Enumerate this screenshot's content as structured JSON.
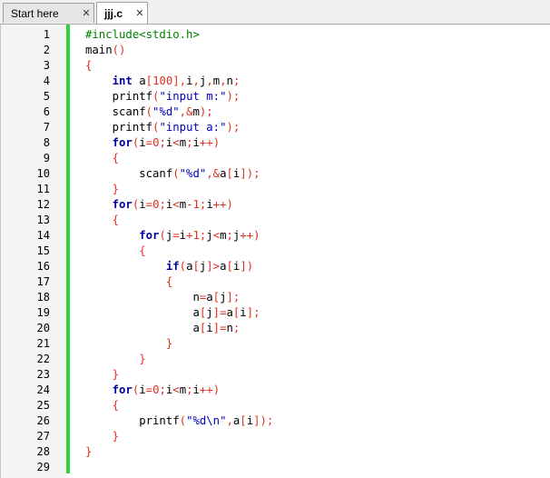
{
  "tabs": [
    {
      "label": "Start here",
      "close": "✕",
      "active": false
    },
    {
      "label": "jjj.c",
      "close": "✕",
      "active": true
    }
  ],
  "editor": {
    "line_numbers": [
      "1",
      "2",
      "3",
      "4",
      "5",
      "6",
      "7",
      "8",
      "9",
      "10",
      "11",
      "12",
      "13",
      "14",
      "15",
      "16",
      "17",
      "18",
      "19",
      "20",
      "21",
      "22",
      "23",
      "24",
      "25",
      "26",
      "27",
      "28",
      "29"
    ],
    "lines": [
      [
        {
          "t": "#include<stdio.h>",
          "c": "pp"
        }
      ],
      [
        {
          "t": "main",
          "c": ""
        },
        {
          "t": "()",
          "c": "br"
        }
      ],
      [
        {
          "t": "{",
          "c": "br"
        }
      ],
      [
        {
          "t": "    ",
          "c": ""
        },
        {
          "t": "int",
          "c": "kw"
        },
        {
          "t": " a",
          "c": ""
        },
        {
          "t": "[",
          "c": "br"
        },
        {
          "t": "100",
          "c": "num-lit"
        },
        {
          "t": "],",
          "c": "br"
        },
        {
          "t": "i",
          "c": ""
        },
        {
          "t": ",",
          "c": "br"
        },
        {
          "t": "j",
          "c": ""
        },
        {
          "t": ",",
          "c": "br"
        },
        {
          "t": "m",
          "c": ""
        },
        {
          "t": ",",
          "c": "br"
        },
        {
          "t": "n",
          "c": ""
        },
        {
          "t": ";",
          "c": "br"
        }
      ],
      [
        {
          "t": "    printf",
          "c": ""
        },
        {
          "t": "(",
          "c": "br"
        },
        {
          "t": "\"input m:\"",
          "c": "str"
        },
        {
          "t": ");",
          "c": "br"
        }
      ],
      [
        {
          "t": "    scanf",
          "c": ""
        },
        {
          "t": "(",
          "c": "br"
        },
        {
          "t": "\"%d\"",
          "c": "str"
        },
        {
          "t": ",&",
          "c": "br"
        },
        {
          "t": "m",
          "c": ""
        },
        {
          "t": ");",
          "c": "br"
        }
      ],
      [
        {
          "t": "    printf",
          "c": ""
        },
        {
          "t": "(",
          "c": "br"
        },
        {
          "t": "\"input a:\"",
          "c": "str"
        },
        {
          "t": ");",
          "c": "br"
        }
      ],
      [
        {
          "t": "    ",
          "c": ""
        },
        {
          "t": "for",
          "c": "kw"
        },
        {
          "t": "(",
          "c": "br"
        },
        {
          "t": "i",
          "c": ""
        },
        {
          "t": "=",
          "c": "br"
        },
        {
          "t": "0",
          "c": "num-lit"
        },
        {
          "t": ";",
          "c": "br"
        },
        {
          "t": "i",
          "c": ""
        },
        {
          "t": "<",
          "c": "br"
        },
        {
          "t": "m",
          "c": ""
        },
        {
          "t": ";",
          "c": "br"
        },
        {
          "t": "i",
          "c": ""
        },
        {
          "t": "++)",
          "c": "br"
        }
      ],
      [
        {
          "t": "    ",
          "c": ""
        },
        {
          "t": "{",
          "c": "br"
        }
      ],
      [
        {
          "t": "        scanf",
          "c": ""
        },
        {
          "t": "(",
          "c": "br"
        },
        {
          "t": "\"%d\"",
          "c": "str"
        },
        {
          "t": ",&",
          "c": "br"
        },
        {
          "t": "a",
          "c": ""
        },
        {
          "t": "[",
          "c": "br"
        },
        {
          "t": "i",
          "c": ""
        },
        {
          "t": "]);",
          "c": "br"
        }
      ],
      [
        {
          "t": "    ",
          "c": ""
        },
        {
          "t": "}",
          "c": "br"
        }
      ],
      [
        {
          "t": "    ",
          "c": ""
        },
        {
          "t": "for",
          "c": "kw"
        },
        {
          "t": "(",
          "c": "br"
        },
        {
          "t": "i",
          "c": ""
        },
        {
          "t": "=",
          "c": "br"
        },
        {
          "t": "0",
          "c": "num-lit"
        },
        {
          "t": ";",
          "c": "br"
        },
        {
          "t": "i",
          "c": ""
        },
        {
          "t": "<",
          "c": "br"
        },
        {
          "t": "m",
          "c": ""
        },
        {
          "t": "-",
          "c": "br"
        },
        {
          "t": "1",
          "c": "num-lit"
        },
        {
          "t": ";",
          "c": "br"
        },
        {
          "t": "i",
          "c": ""
        },
        {
          "t": "++)",
          "c": "br"
        }
      ],
      [
        {
          "t": "    ",
          "c": ""
        },
        {
          "t": "{",
          "c": "br"
        }
      ],
      [
        {
          "t": "        ",
          "c": ""
        },
        {
          "t": "for",
          "c": "kw"
        },
        {
          "t": "(",
          "c": "br"
        },
        {
          "t": "j",
          "c": ""
        },
        {
          "t": "=",
          "c": "br"
        },
        {
          "t": "i",
          "c": ""
        },
        {
          "t": "+",
          "c": "br"
        },
        {
          "t": "1",
          "c": "num-lit"
        },
        {
          "t": ";",
          "c": "br"
        },
        {
          "t": "j",
          "c": ""
        },
        {
          "t": "<",
          "c": "br"
        },
        {
          "t": "m",
          "c": ""
        },
        {
          "t": ";",
          "c": "br"
        },
        {
          "t": "j",
          "c": ""
        },
        {
          "t": "++)",
          "c": "br"
        }
      ],
      [
        {
          "t": "        ",
          "c": ""
        },
        {
          "t": "{",
          "c": "br"
        }
      ],
      [
        {
          "t": "            ",
          "c": ""
        },
        {
          "t": "if",
          "c": "kw"
        },
        {
          "t": "(",
          "c": "br"
        },
        {
          "t": "a",
          "c": ""
        },
        {
          "t": "[",
          "c": "br"
        },
        {
          "t": "j",
          "c": ""
        },
        {
          "t": "]>",
          "c": "br"
        },
        {
          "t": "a",
          "c": ""
        },
        {
          "t": "[",
          "c": "br"
        },
        {
          "t": "i",
          "c": ""
        },
        {
          "t": "])",
          "c": "br"
        }
      ],
      [
        {
          "t": "            ",
          "c": ""
        },
        {
          "t": "{",
          "c": "br"
        }
      ],
      [
        {
          "t": "                n",
          "c": ""
        },
        {
          "t": "=",
          "c": "br"
        },
        {
          "t": "a",
          "c": ""
        },
        {
          "t": "[",
          "c": "br"
        },
        {
          "t": "j",
          "c": ""
        },
        {
          "t": "];",
          "c": "br"
        }
      ],
      [
        {
          "t": "                a",
          "c": ""
        },
        {
          "t": "[",
          "c": "br"
        },
        {
          "t": "j",
          "c": ""
        },
        {
          "t": "]=",
          "c": "br"
        },
        {
          "t": "a",
          "c": ""
        },
        {
          "t": "[",
          "c": "br"
        },
        {
          "t": "i",
          "c": ""
        },
        {
          "t": "];",
          "c": "br"
        }
      ],
      [
        {
          "t": "                a",
          "c": ""
        },
        {
          "t": "[",
          "c": "br"
        },
        {
          "t": "i",
          "c": ""
        },
        {
          "t": "]=",
          "c": "br"
        },
        {
          "t": "n",
          "c": ""
        },
        {
          "t": ";",
          "c": "br"
        }
      ],
      [
        {
          "t": "            ",
          "c": ""
        },
        {
          "t": "}",
          "c": "br"
        }
      ],
      [
        {
          "t": "        ",
          "c": ""
        },
        {
          "t": "}",
          "c": "br"
        }
      ],
      [
        {
          "t": "    ",
          "c": ""
        },
        {
          "t": "}",
          "c": "br"
        }
      ],
      [
        {
          "t": "    ",
          "c": ""
        },
        {
          "t": "for",
          "c": "kw"
        },
        {
          "t": "(",
          "c": "br"
        },
        {
          "t": "i",
          "c": ""
        },
        {
          "t": "=",
          "c": "br"
        },
        {
          "t": "0",
          "c": "num-lit"
        },
        {
          "t": ";",
          "c": "br"
        },
        {
          "t": "i",
          "c": ""
        },
        {
          "t": "<",
          "c": "br"
        },
        {
          "t": "m",
          "c": ""
        },
        {
          "t": ";",
          "c": "br"
        },
        {
          "t": "i",
          "c": ""
        },
        {
          "t": "++)",
          "c": "br"
        }
      ],
      [
        {
          "t": "    ",
          "c": ""
        },
        {
          "t": "{",
          "c": "br"
        }
      ],
      [
        {
          "t": "        printf",
          "c": ""
        },
        {
          "t": "(",
          "c": "br"
        },
        {
          "t": "\"%d\\n\"",
          "c": "str"
        },
        {
          "t": ",",
          "c": "br"
        },
        {
          "t": "a",
          "c": ""
        },
        {
          "t": "[",
          "c": "br"
        },
        {
          "t": "i",
          "c": ""
        },
        {
          "t": "]);",
          "c": "br"
        }
      ],
      [
        {
          "t": "    ",
          "c": ""
        },
        {
          "t": "}",
          "c": "br"
        }
      ],
      [
        {
          "t": "}",
          "c": "br"
        }
      ],
      []
    ]
  }
}
